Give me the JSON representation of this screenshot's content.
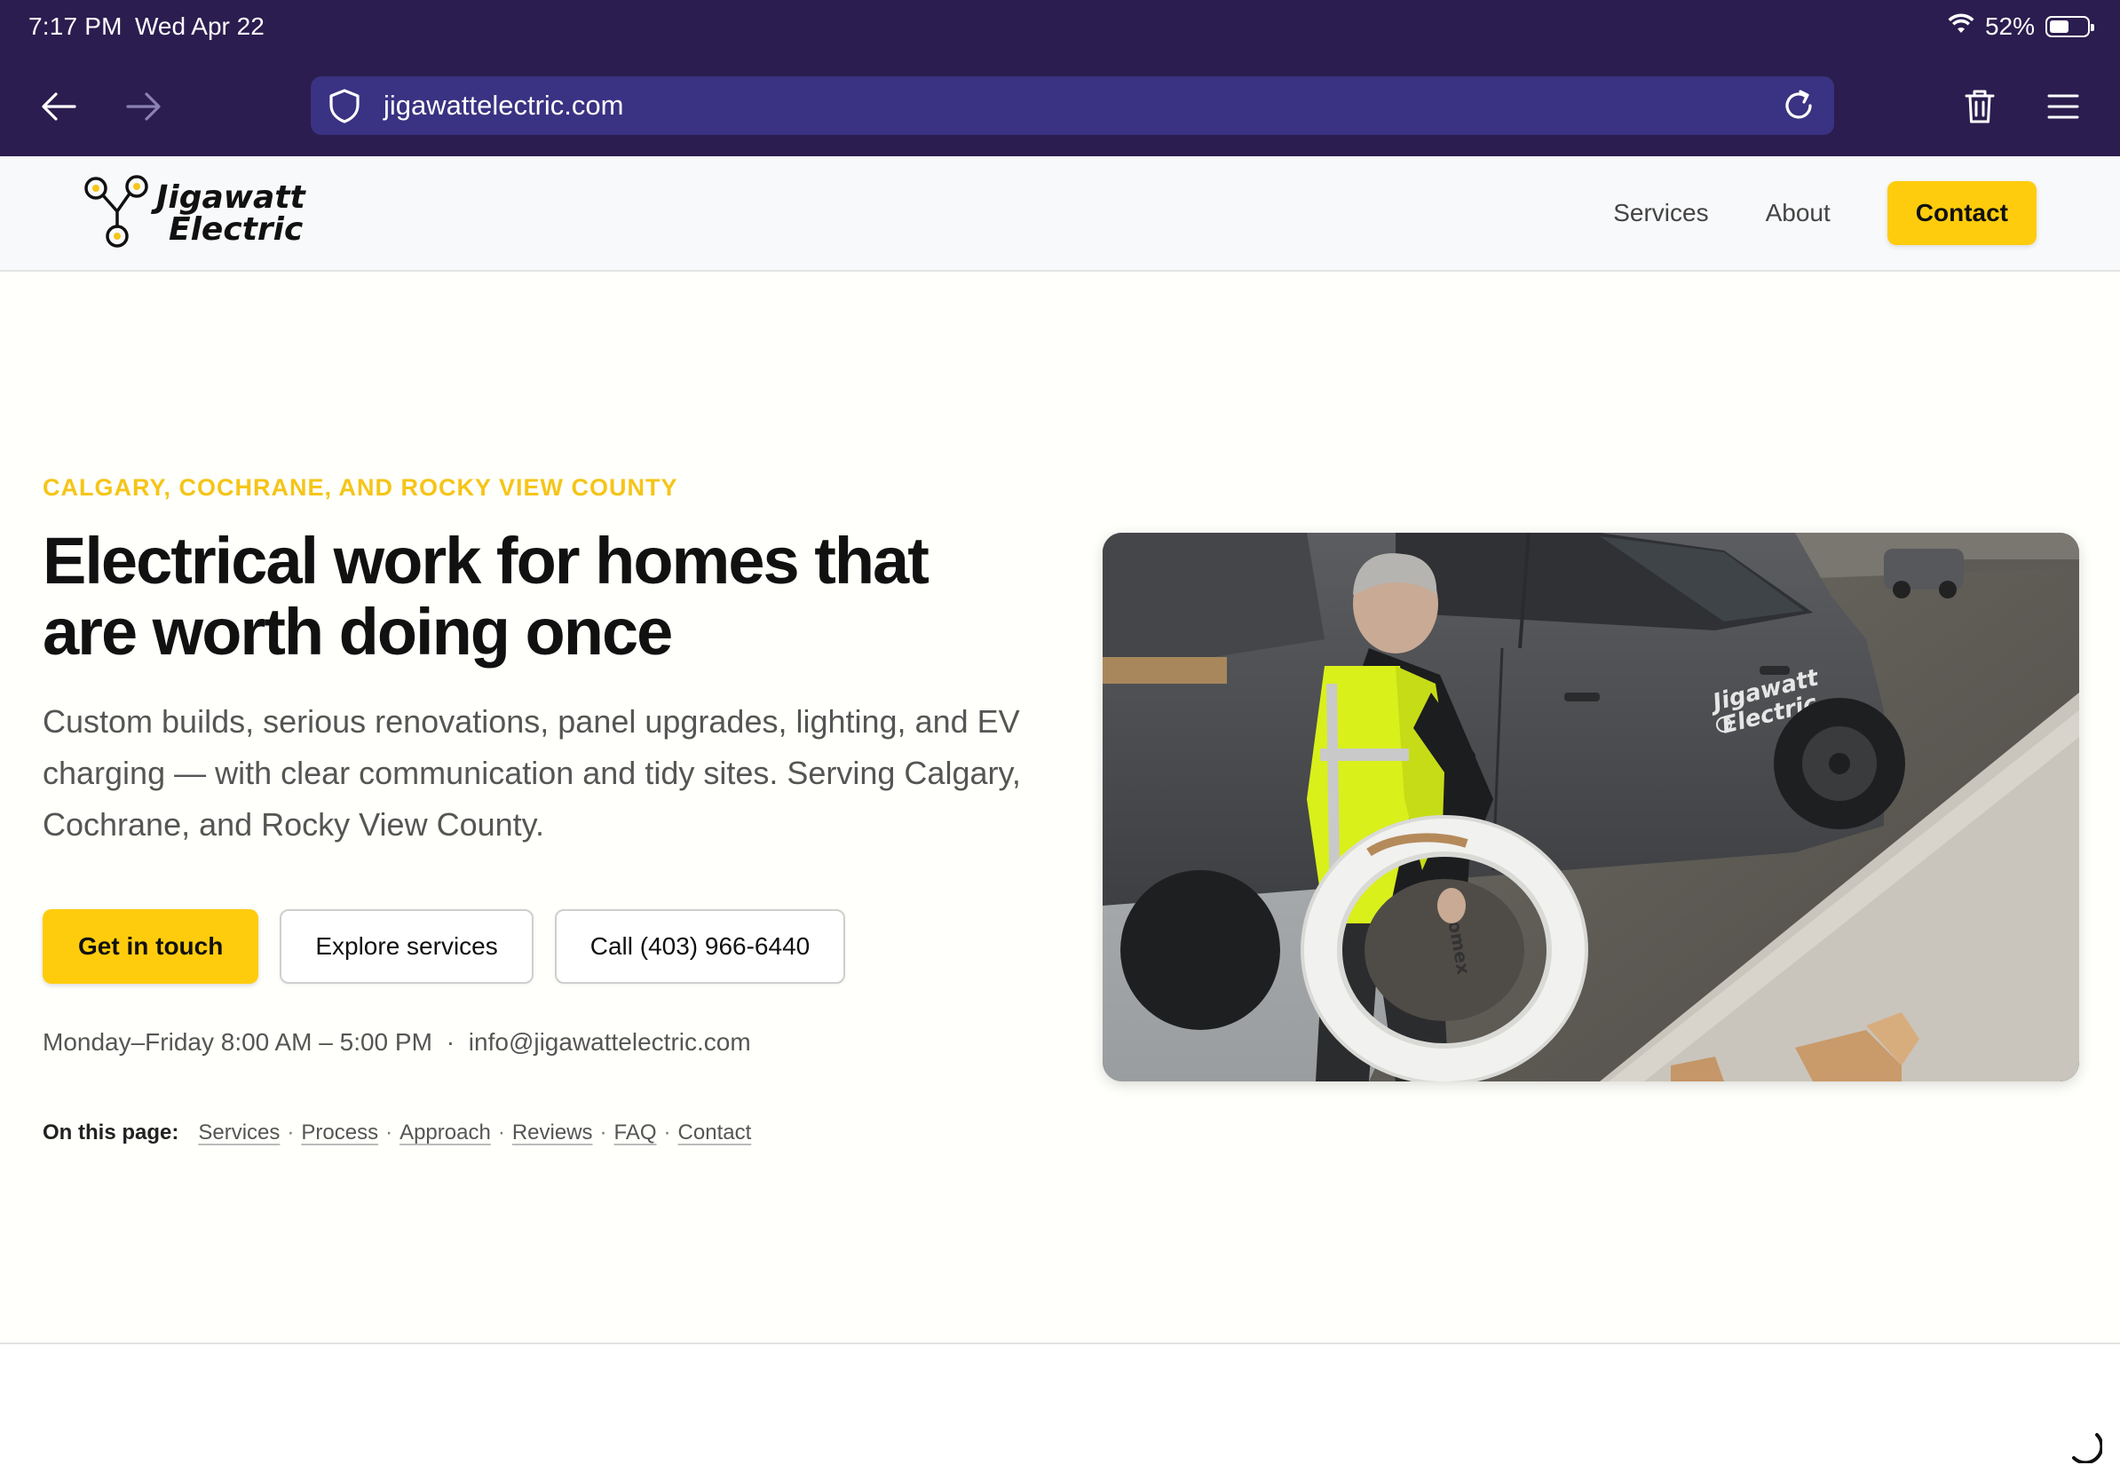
{
  "status_bar": {
    "time": "7:17 PM",
    "date": "Wed Apr 22",
    "battery": "52%",
    "battery_level": 0.52,
    "wifi_icon": "wifi-icon"
  },
  "browser": {
    "url": "jigawattelectric.com",
    "icons": {
      "back": "back-arrow-icon",
      "forward": "forward-arrow-icon",
      "shield": "shield-icon",
      "reload": "reload-icon",
      "trash": "trash-icon",
      "menu": "hamburger-menu-icon"
    }
  },
  "header": {
    "logo_line1": "Jigawatt",
    "logo_line2": "Electric",
    "nav": {
      "services": "Services",
      "about": "About",
      "contact": "Contact"
    }
  },
  "hero": {
    "eyebrow": "CALGARY, COCHRANE, AND ROCKY VIEW COUNTY",
    "headline": "Electrical work for homes that are worth doing once",
    "lead": "Custom builds, serious renovations, panel upgrades, lighting, and EV charging — with clear communication and tidy sites. Serving Calgary, Cochrane, and Rocky View County.",
    "cta": {
      "primary": "Get in touch",
      "services": "Explore services",
      "call": "Call (403) 966-6440"
    },
    "hours": "Monday–Friday 8:00 AM – 5:00 PM",
    "separator": "·",
    "email": "info@jigawattelectric.com",
    "on_this_page": {
      "label": "On this page:",
      "links": [
        "Services",
        "Process",
        "Approach",
        "Reviews",
        "FAQ",
        "Contact"
      ]
    },
    "photo": {
      "truck_logo_line1": "Jigawatt",
      "truck_logo_line2": "Electric",
      "cable_label": "Loomex"
    }
  },
  "colors": {
    "chrome_bg": "#2b1d4f",
    "urlbar_bg": "#3a3282",
    "accent_yellow": "#ffcc0d",
    "eyebrow_yellow": "#f5c518"
  }
}
